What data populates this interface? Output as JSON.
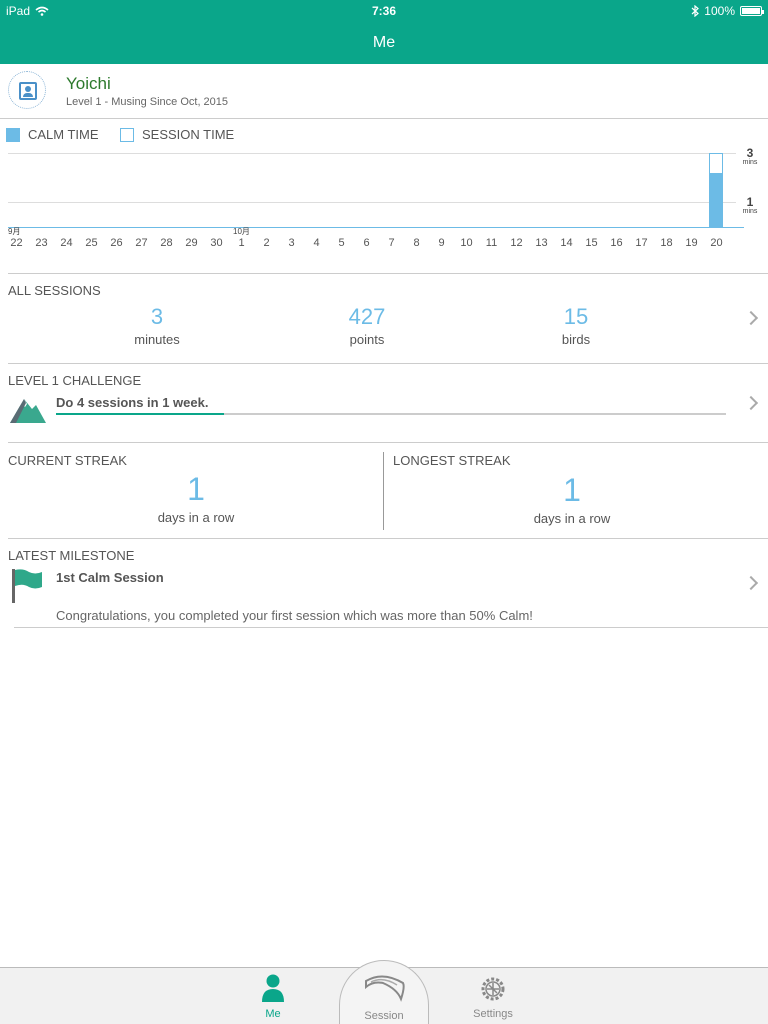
{
  "status_bar": {
    "device": "iPad",
    "time": "7:36",
    "battery": "100%"
  },
  "nav": {
    "title": "Me"
  },
  "profile": {
    "name": "Yoichi",
    "subtitle": "Level 1 - Musing Since Oct, 2015"
  },
  "legend": {
    "calm": "CALM TIME",
    "session": "SESSION TIME"
  },
  "colors": {
    "accent": "#0aa68a",
    "chart_blue": "#6cbbe6",
    "name_green": "#2d7a2d"
  },
  "chart_data": {
    "type": "bar",
    "categories": [
      "22",
      "23",
      "24",
      "25",
      "26",
      "27",
      "28",
      "29",
      "30",
      "1",
      "2",
      "3",
      "4",
      "5",
      "6",
      "7",
      "8",
      "9",
      "10",
      "11",
      "12",
      "13",
      "14",
      "15",
      "16",
      "17",
      "18",
      "19",
      "20"
    ],
    "month_labels": [
      {
        "label": "9月",
        "at": "22"
      },
      {
        "label": "10月",
        "at": "1"
      }
    ],
    "series": [
      {
        "name": "CALM TIME",
        "values": [
          0,
          0,
          0,
          0,
          0,
          0,
          0,
          0,
          0,
          0,
          0,
          0,
          0,
          0,
          0,
          0,
          0,
          0,
          0,
          0,
          0,
          0,
          0,
          0,
          0,
          0,
          0,
          0,
          2.2
        ]
      },
      {
        "name": "SESSION TIME",
        "values": [
          0,
          0,
          0,
          0,
          0,
          0,
          0,
          0,
          0,
          0,
          0,
          0,
          0,
          0,
          0,
          0,
          0,
          0,
          0,
          0,
          0,
          0,
          0,
          0,
          0,
          0,
          0,
          0,
          3
        ]
      }
    ],
    "yticks": [
      {
        "value": 3,
        "label": "3",
        "unit": "mins"
      },
      {
        "value": 1,
        "label": "1",
        "unit": "mins"
      }
    ],
    "ylim": [
      0,
      3
    ]
  },
  "all_sessions": {
    "title": "ALL SESSIONS",
    "stats": [
      {
        "value": "3",
        "label": "minutes"
      },
      {
        "value": "427",
        "label": "points"
      },
      {
        "value": "15",
        "label": "birds"
      }
    ]
  },
  "challenge": {
    "title": "LEVEL 1 CHALLENGE",
    "text": "Do 4 sessions in 1 week.",
    "progress": 0.25
  },
  "streaks": {
    "current": {
      "title": "CURRENT STREAK",
      "value": "1",
      "label": "days in a row"
    },
    "longest": {
      "title": "LONGEST STREAK",
      "value": "1",
      "label": "days in a row"
    }
  },
  "milestone": {
    "title": "LATEST MILESTONE",
    "name": "1st Calm Session",
    "description": "Congratulations, you completed your first session which was more than 50% Calm!"
  },
  "tabs": {
    "me": "Me",
    "session": "Session",
    "settings": "Settings"
  }
}
